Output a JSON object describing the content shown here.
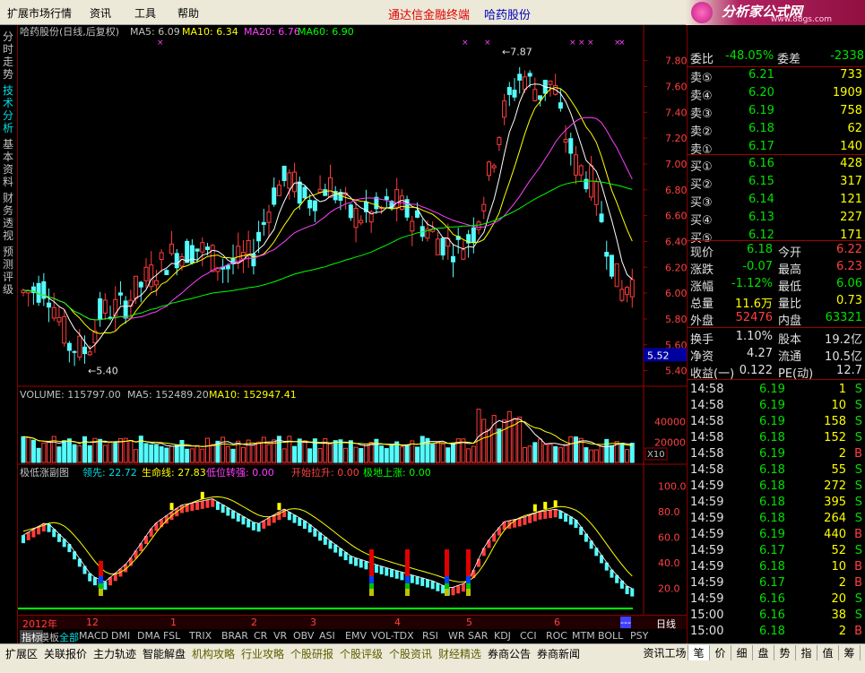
{
  "menu": {
    "items": [
      "扩展市场行情",
      "资讯",
      "工具",
      "帮助"
    ],
    "notice": "通达信金融终端",
    "stock_name": "哈药股份"
  },
  "brand": {
    "title": "分析家公式网",
    "url": "www.88gs.com"
  },
  "left_tabs": [
    "分时走势",
    "技术分析",
    "基本资料",
    "财务透视",
    "预测评级"
  ],
  "left_tabs_active_index": 1,
  "kline": {
    "title": "哈药股份(日线,后复权)",
    "ma5": "MA5: 6.09",
    "ma10": "MA10: 6.34",
    "ma20": "MA20: 6.76",
    "ma60": "MA60: 6.90",
    "high_label": "7.87",
    "low_label": "5.40",
    "cursor_price": "5.52",
    "y_ticks": [
      "7.80",
      "7.60",
      "7.40",
      "7.20",
      "7.00",
      "6.80",
      "6.60",
      "6.40",
      "6.20",
      "6.00",
      "5.80",
      "5.60",
      "5.40"
    ],
    "y_range": [
      5.3,
      7.95
    ]
  },
  "volume": {
    "header": "VOLUME: 115797.00",
    "ma5": "MA5: 152489.20",
    "ma10": "MA10: 152947.41",
    "y_ticks": [
      "40000",
      "20000"
    ],
    "unit": "X10"
  },
  "indicator": {
    "name": "极低涨副图",
    "lead": "领先: 22.72",
    "life": "生命线: 27.83",
    "low_turn": "低位转强: 0.00",
    "start_pull": "开始拉升: 0.00",
    "ground_rise": "极地上涨: 0.00",
    "y_ticks": [
      "100.0",
      "80.0",
      "60.0",
      "40.0",
      "20.0"
    ]
  },
  "date_axis": {
    "labels": [
      "2012年",
      "12",
      "1",
      "2",
      "3",
      "4",
      "5",
      "6"
    ],
    "period": "日线"
  },
  "indicator_tabs": [
    "指标",
    "模板",
    "全部",
    "MACD",
    "DMI",
    "DMA",
    "FSL",
    "TRIX",
    "BRAR",
    "CR",
    "VR",
    "OBV",
    "ASI",
    "EMV",
    "VOL-TDX",
    "RSI",
    "WR",
    "SAR",
    "KDJ",
    "CCI",
    "ROC",
    "MTM",
    "BOLL",
    "PSY"
  ],
  "quote": {
    "ratio_label": "委比",
    "ratio": "-48.05%",
    "diff_label": "委差",
    "diff": "-2338",
    "sell": [
      {
        "label": "卖⑤",
        "price": "6.21",
        "vol": "733"
      },
      {
        "label": "卖④",
        "price": "6.20",
        "vol": "1909"
      },
      {
        "label": "卖③",
        "price": "6.19",
        "vol": "758"
      },
      {
        "label": "卖②",
        "price": "6.18",
        "vol": "62"
      },
      {
        "label": "卖①",
        "price": "6.17",
        "vol": "140"
      }
    ],
    "buy": [
      {
        "label": "买①",
        "price": "6.16",
        "vol": "428"
      },
      {
        "label": "买②",
        "price": "6.15",
        "vol": "317"
      },
      {
        "label": "买③",
        "price": "6.14",
        "vol": "121"
      },
      {
        "label": "买④",
        "price": "6.13",
        "vol": "227"
      },
      {
        "label": "买⑤",
        "price": "6.12",
        "vol": "171"
      }
    ],
    "stats": [
      {
        "l1": "现价",
        "v1": "6.18",
        "l2": "今开",
        "v2": "6.22",
        "c1": "green",
        "c2": "red"
      },
      {
        "l1": "涨跌",
        "v1": "-0.07",
        "l2": "最高",
        "v2": "6.23",
        "c1": "green",
        "c2": "red"
      },
      {
        "l1": "涨幅",
        "v1": "-1.12%",
        "l2": "最低",
        "v2": "6.06",
        "c1": "green",
        "c2": "green"
      },
      {
        "l1": "总量",
        "v1": "11.6万",
        "l2": "量比",
        "v2": "0.73",
        "c1": "yellow",
        "c2": "yellow"
      },
      {
        "l1": "外盘",
        "v1": "52476",
        "l2": "内盘",
        "v2": "63321",
        "c1": "red",
        "c2": "green"
      }
    ],
    "stats2": [
      {
        "l1": "换手",
        "v1": "1.10%",
        "l2": "股本",
        "v2": "19.2亿"
      },
      {
        "l1": "净资",
        "v1": "4.27",
        "l2": "流通",
        "v2": "10.5亿"
      },
      {
        "l1": "收益(一)",
        "v1": "0.122",
        "l2": "PE(动)",
        "v2": "12.7"
      }
    ]
  },
  "ticks": [
    {
      "time": "14:58",
      "price": "6.19",
      "vol": "1",
      "bs": "S"
    },
    {
      "time": "14:58",
      "price": "6.19",
      "vol": "10",
      "bs": "S"
    },
    {
      "time": "14:58",
      "price": "6.19",
      "vol": "158",
      "bs": "S"
    },
    {
      "time": "14:58",
      "price": "6.18",
      "vol": "152",
      "bs": "S"
    },
    {
      "time": "14:58",
      "price": "6.19",
      "vol": "2",
      "bs": "B"
    },
    {
      "time": "14:58",
      "price": "6.18",
      "vol": "55",
      "bs": "S"
    },
    {
      "time": "14:59",
      "price": "6.18",
      "vol": "272",
      "bs": "S"
    },
    {
      "time": "14:59",
      "price": "6.18",
      "vol": "395",
      "bs": "S"
    },
    {
      "time": "14:59",
      "price": "6.18",
      "vol": "264",
      "bs": "S"
    },
    {
      "time": "14:59",
      "price": "6.19",
      "vol": "440",
      "bs": "B"
    },
    {
      "time": "14:59",
      "price": "6.17",
      "vol": "52",
      "bs": "S"
    },
    {
      "time": "14:59",
      "price": "6.18",
      "vol": "10",
      "bs": "B"
    },
    {
      "time": "14:59",
      "price": "6.17",
      "vol": "2",
      "bs": "B"
    },
    {
      "time": "14:59",
      "price": "6.16",
      "vol": "20",
      "bs": "S"
    },
    {
      "time": "15:00",
      "price": "6.16",
      "vol": "38",
      "bs": "S"
    },
    {
      "time": "15:00",
      "price": "6.18",
      "vol": "2",
      "bs": "B"
    }
  ],
  "status_bar": [
    "扩展区",
    "关联报价",
    "主力轨迹",
    "智能解盘",
    "机构攻略",
    "行业攻略",
    "个股研报",
    "个股评级",
    "个股资讯",
    "财经精选",
    "券商公告",
    "券商新闻"
  ],
  "right_tabs": [
    "资讯工场",
    "笔",
    "价",
    "细",
    "盘",
    "势",
    "指",
    "值",
    "筹"
  ]
}
